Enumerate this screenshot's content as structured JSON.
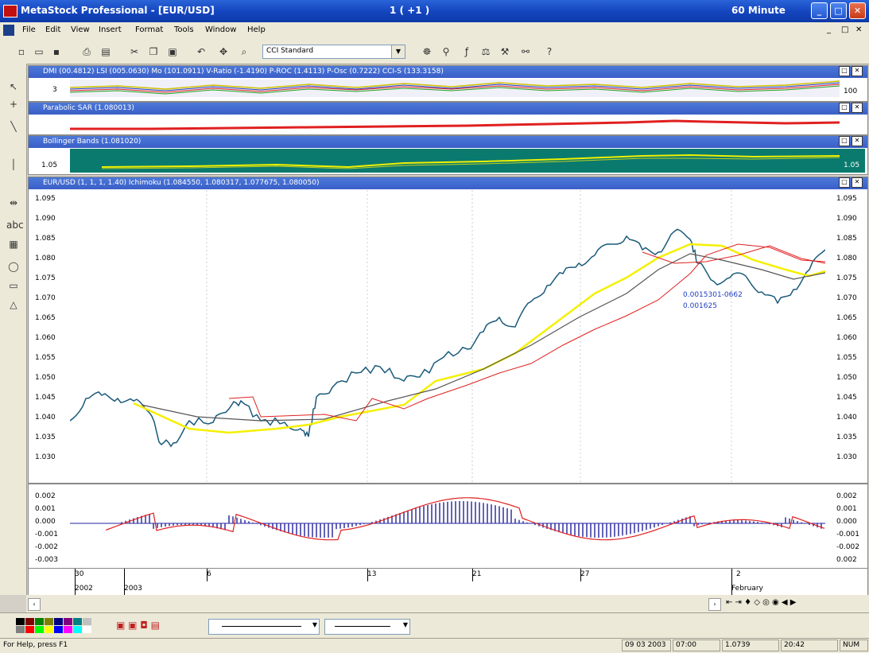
{
  "window": {
    "title": "MetaStock Professional - [EUR/USD]",
    "center_title": "1 ( +1 )",
    "interval": "60 Minute"
  },
  "menu": [
    "File",
    "Edit",
    "View",
    "Insert",
    "Format",
    "Tools",
    "Window",
    "Help"
  ],
  "toolbar": {
    "style_select": "CCI Standard"
  },
  "panes": {
    "indicators": {
      "header": "DMI (00.4812)  LSI (005.0630)  Mo (101.0911)  V-Ratio (-1.4190)  P-ROC (1.4113)  P-Osc (0.7222)  CCI-S (133.3158)",
      "left_value": "3",
      "right_value": "100"
    },
    "sar": {
      "header": "Parabolic SAR (1.080013)"
    },
    "bollinger": {
      "header": "Bollinger Bands (1.081020)",
      "left_value": "1.05",
      "right_value": "1.05"
    },
    "price": {
      "header": "EUR/USD (1, 1, 1, 1.40)  Ichimoku (1.084550, 1.080317, 1.077675, 1.080050)",
      "annotation_1": "0.0015301-0662",
      "annotation_2": "0.001625",
      "y_ticks": [
        "1.095",
        "1.090",
        "1.085",
        "1.080",
        "1.075",
        "1.070",
        "1.065",
        "1.060",
        "1.055",
        "1.050",
        "1.045",
        "1.040",
        "1.035",
        "1.030"
      ]
    },
    "macd": {
      "y_ticks": [
        "0.002",
        "0.001",
        "0.000",
        "-0.001",
        "-0.002",
        "-0.003"
      ],
      "y_ticks_right": [
        "0.002",
        "0.001",
        "0.000",
        "-0.001",
        "-0.002",
        "0.002"
      ]
    }
  },
  "x_axis": {
    "ticks": [
      "30",
      "6",
      "13",
      "21",
      "27",
      "2"
    ],
    "years": [
      "2002",
      "2003"
    ],
    "month": "February"
  },
  "statusbar": {
    "help": "For Help, press F1",
    "date": "09 03 2003",
    "time": "07:00",
    "price": "1.0739",
    "clock": "20:42",
    "mode": "NUM"
  },
  "colors": {
    "price_line": "#1a5a7a",
    "ma_yellow": "#f5f000",
    "ma_gray": "#555555",
    "red_line": "#e02020",
    "macd_bar": "#3030a0",
    "bollinger_bg": "#0a7a6e"
  }
}
